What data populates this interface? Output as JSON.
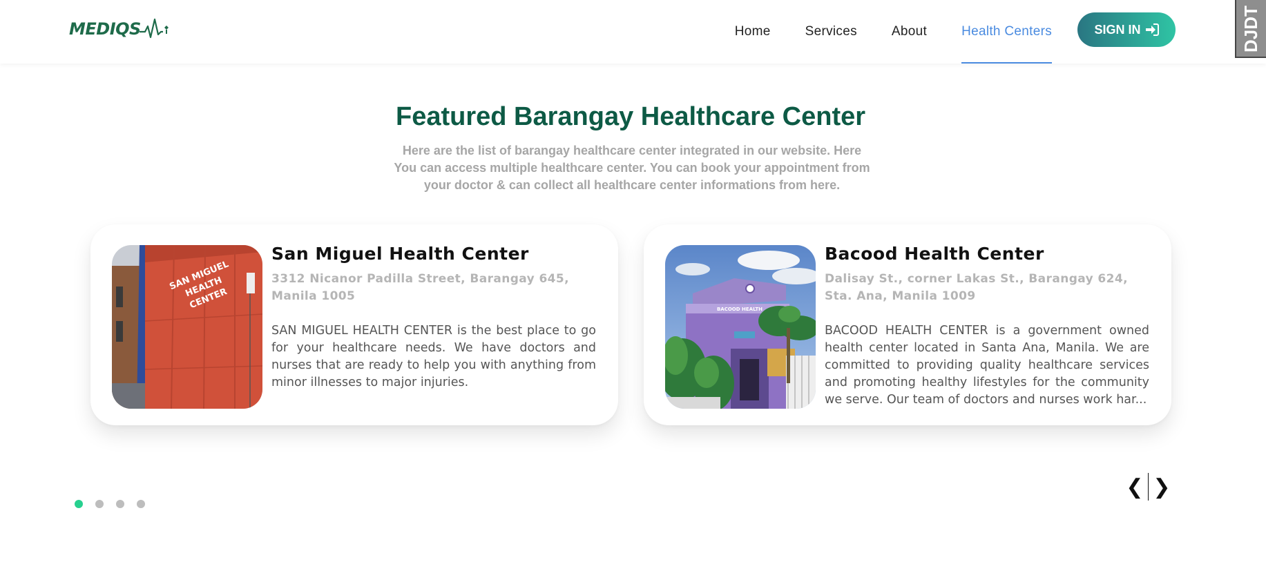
{
  "header": {
    "logo_text": "MEDIQS",
    "nav": [
      {
        "label": "Home",
        "active": false
      },
      {
        "label": "Services",
        "active": false
      },
      {
        "label": "About",
        "active": false
      },
      {
        "label": "Health Centers",
        "active": true
      }
    ],
    "signin_label": "SIGN IN",
    "signin_icon": "sign-in-icon",
    "corner_badge": "DJDT"
  },
  "section": {
    "title": "Featured Barangay Healthcare Center",
    "subtitle": "Here are the list of barangay healthcare center integrated in our website. Here You can access multiple healthcare center. You can book your appointment from your doctor & can collect all healthcare center informations from here."
  },
  "centers": [
    {
      "name": "San Miguel Health Center",
      "address": "3312 Nicanor Padilla Street, Barangay 645, Manila 1005",
      "description": "SAN MIGUEL HEALTH CENTER is the best place to go for your healthcare needs. We have doctors and nurses that are ready to help you with anything from minor illnesses to major injuries.",
      "sign_text": "SAN MIGUEL HEALTH CENTER"
    },
    {
      "name": "Bacood Health Center",
      "address": "Dalisay St., corner Lakas St., Barangay 624, Sta. Ana, Manila 1009",
      "description": "BACOOD HEALTH CENTER is a government owned health center located in Santa Ana, Manila. We are committed to providing quality healthcare services and promoting healthy lifestyles for the community we serve. Our team of doctors and nurses work har...",
      "sign_text": "BACOOD HEALTH"
    }
  ],
  "carousel": {
    "dot_count": 4,
    "active_index": 0,
    "prev_label": "❮",
    "next_label": "❯"
  },
  "colors": {
    "brand_green": "#0d5a45",
    "nav_active": "#4a8be0",
    "dot_active": "#27d08f",
    "dot_inactive": "#bdbdbd"
  }
}
